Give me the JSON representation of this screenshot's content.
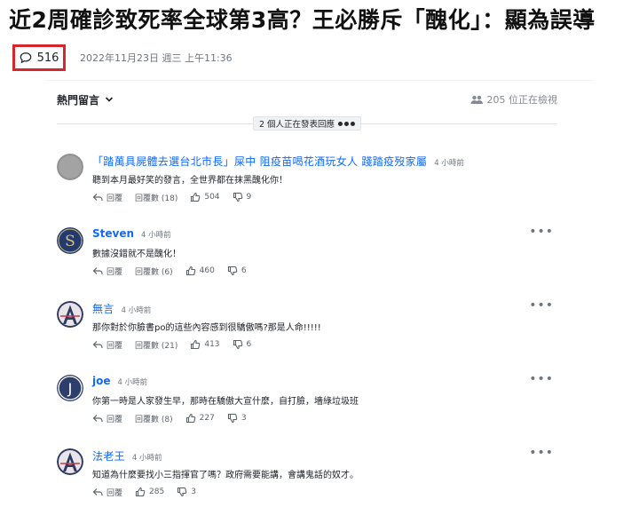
{
  "article": {
    "headline": "近2周確診致死率全球第3高？王必勝斥「醜化」：顯為誤導",
    "comment_count": "516",
    "timestamp": "2022年11月23日 週三 上午11:36"
  },
  "comments_panel": {
    "sort_label": "熱門留言",
    "viewers_text": "205 位正在檢視",
    "typing_text": "2 個人正在發表回應"
  },
  "labels": {
    "reply": "回覆",
    "replies_prefix": "回覆數"
  },
  "comments": [
    {
      "username": "「踏萬具屍體去選台北市長」屎中 阻疫苗喝花酒玩女人 踐踏疫歿家屬",
      "time": "4 小時前",
      "text": "聽到本月最好笑的發言，全世界都在抹黑醜化你！",
      "replies": "回覆數 (18)",
      "likes": "504",
      "dislikes": "9",
      "avatar_icon": "grey-avatar-icon"
    },
    {
      "username": "Steven",
      "time": "4 小時前",
      "text": "數據沒錯就不是醜化！",
      "replies": "回覆數 (6)",
      "likes": "460",
      "dislikes": "6",
      "avatar_icon": "letter-s-avatar-icon"
    },
    {
      "username": "無言",
      "time": "4 小時前",
      "text": "那你對於你臉書po的這些內容感到很驕傲嗎?那是人命!!!!!",
      "replies": "回覆數 (21)",
      "likes": "413",
      "dislikes": "6",
      "avatar_icon": "letter-a-avatar-icon"
    },
    {
      "username": "joe",
      "time": "4 小時前",
      "text": "你第一時是人家發生早，那時在驕傲大宣什麼，自打臉，墻綠垃圾班",
      "replies": "回覆數 (8)",
      "likes": "227",
      "dislikes": "3",
      "avatar_icon": "letter-j-avatar-icon"
    },
    {
      "username": "法老王",
      "time": "4 小時前",
      "text": "知道為什麼要找小三指揮官了嗎？政府需要能講，會講鬼話的奴才。",
      "replies": "",
      "likes": "285",
      "dislikes": "3",
      "avatar_icon": "letter-a-avatar-icon"
    }
  ],
  "colors": {
    "accent": "#0f69ff",
    "highlight_box": "#d6262d",
    "text": "#1d2228",
    "muted": "#6e7780"
  }
}
